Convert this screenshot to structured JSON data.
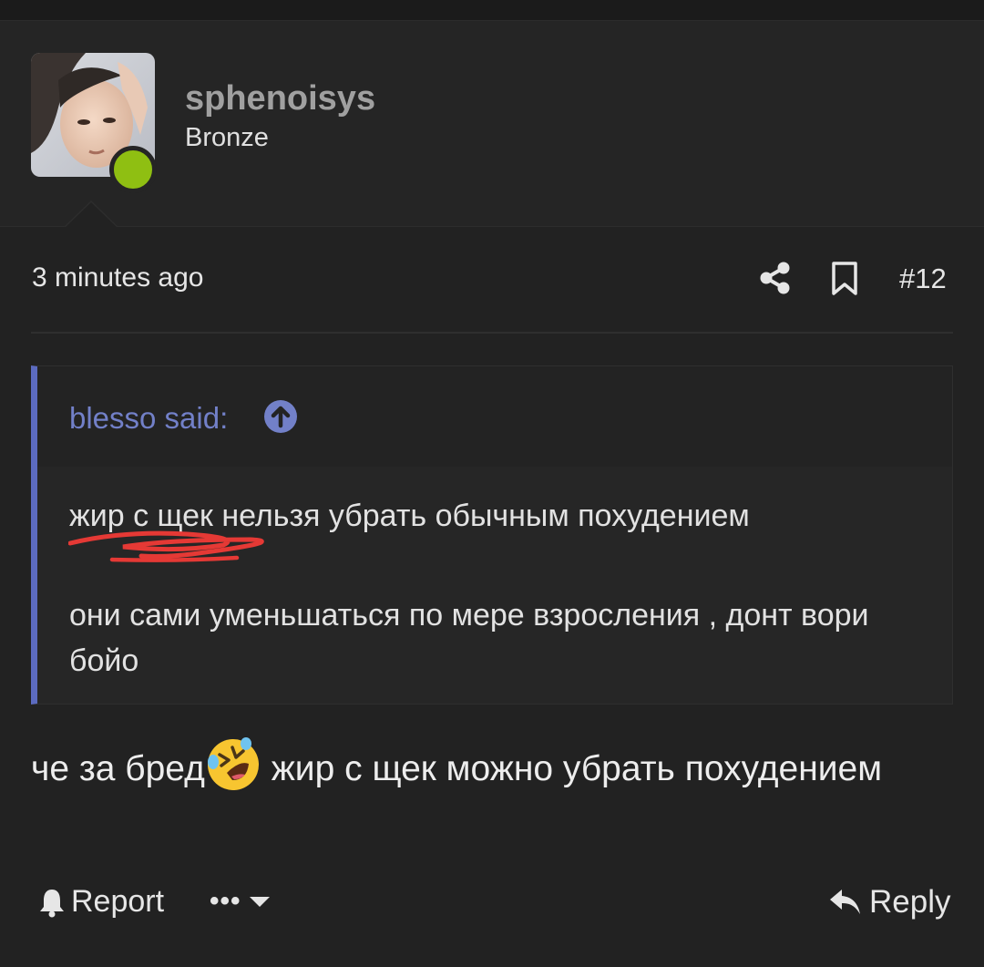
{
  "user": {
    "username": "sphenoisys",
    "rank": "Bronze",
    "status": "online"
  },
  "post": {
    "time": "3 minutes ago",
    "number": "#12",
    "share_icon": "share-icon",
    "bookmark_icon": "bookmark-icon"
  },
  "quote": {
    "author": "blesso said:",
    "paragraph1": "жир с щек нельзя убрать обычным похудением",
    "paragraph2": "они сами уменьшаться по мере взросления , донт вори бойо"
  },
  "message": {
    "part1": "че за бред",
    "emoji": "rolling-on-floor-laughing-emoji",
    "part2": " жир с щек можно убрать похудением"
  },
  "actions": {
    "report": "Report",
    "more": "•••",
    "reply": "Reply"
  },
  "colors": {
    "background": "#222222",
    "quote_accent": "#5c6bc0",
    "online": "#8fbf12",
    "scribble": "#e53935"
  }
}
